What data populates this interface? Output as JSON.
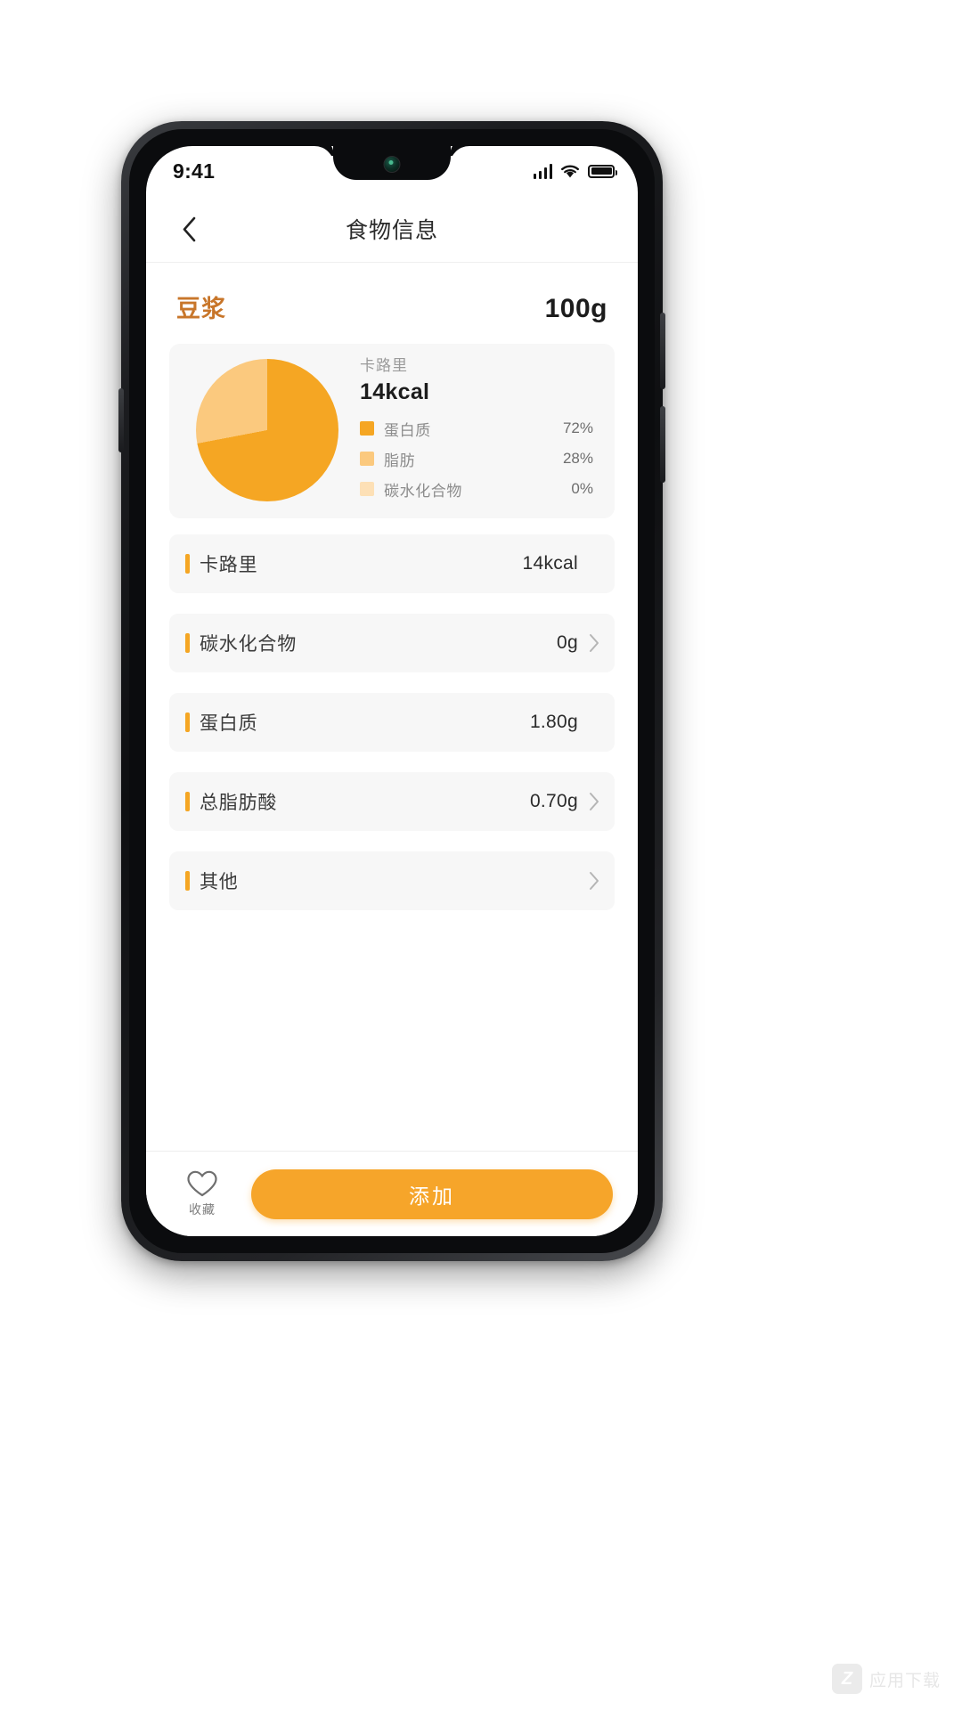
{
  "status_bar": {
    "time": "9:41",
    "signal_icon": "signal-bars-icon",
    "wifi_icon": "wifi-icon",
    "battery_icon": "battery-full-icon"
  },
  "nav": {
    "back_icon": "chevron-left-icon",
    "title": "食物信息"
  },
  "food": {
    "name": "豆浆",
    "weight": "100g"
  },
  "macro_card": {
    "calories_label": "卡路里",
    "calories_value": "14kcal",
    "legend": [
      {
        "name": "蛋白质",
        "percent": "72%",
        "color": "#f5a623"
      },
      {
        "name": "脂肪",
        "percent": "28%",
        "color": "#fbc97e"
      },
      {
        "name": "碳水化合物",
        "percent": "0%",
        "color": "#fde0b6"
      }
    ]
  },
  "chart_data": {
    "type": "pie",
    "title": "卡路里",
    "center_value": "14kcal",
    "categories": [
      "蛋白质",
      "脂肪",
      "碳水化合物"
    ],
    "values": [
      72,
      28,
      0
    ],
    "colors": [
      "#f5a623",
      "#fbc97e",
      "#fde0b6"
    ],
    "unit": "%",
    "legend_position": "right",
    "start_angle_deg": 0
  },
  "nutrients": [
    {
      "label": "卡路里",
      "value": "14kcal",
      "has_chevron": false
    },
    {
      "label": "碳水化合物",
      "value": "0g",
      "has_chevron": true
    },
    {
      "label": "蛋白质",
      "value": "1.80g",
      "has_chevron": false
    },
    {
      "label": "总脂肪酸",
      "value": "0.70g",
      "has_chevron": true
    },
    {
      "label": "其他",
      "value": "",
      "has_chevron": true
    }
  ],
  "bottom_bar": {
    "favorite_icon": "heart-outline-icon",
    "favorite_label": "收藏",
    "add_label": "添加"
  },
  "watermark": {
    "logo_letter": "Z",
    "text": "应用下载"
  },
  "colors": {
    "accent": "#f6a52a",
    "food_name": "#c8762a",
    "card_bg": "#f7f7f7"
  }
}
